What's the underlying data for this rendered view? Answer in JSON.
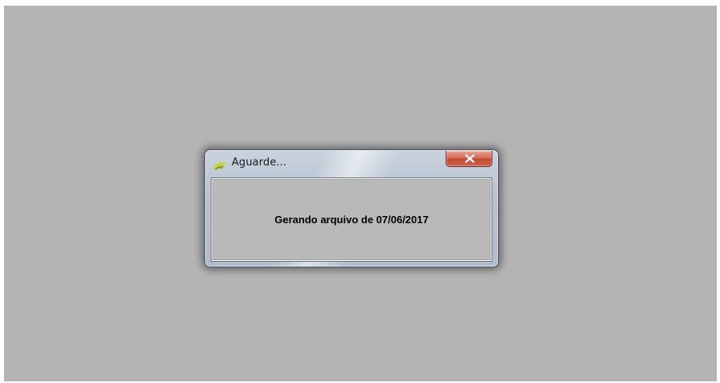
{
  "dialog": {
    "title": "Aguarde...",
    "message": "Gerando arquivo de 07/06/2017",
    "icon": "app-icon",
    "close_icon": "close-icon"
  },
  "colors": {
    "desktop_background": "#b4b4b4",
    "client_background": "#b9b9b9",
    "close_button": "#c94b36"
  }
}
